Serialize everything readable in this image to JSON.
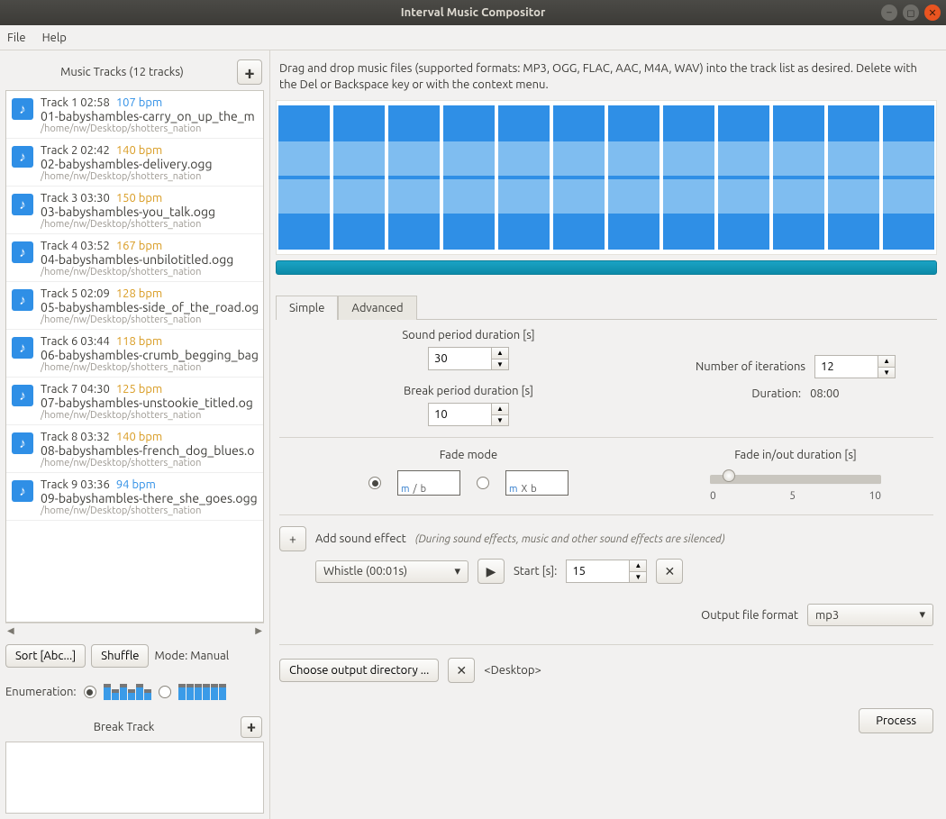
{
  "window": {
    "title": "Interval Music Compositor"
  },
  "menu": {
    "file": "File",
    "help": "Help"
  },
  "sidebar": {
    "tracks_title": "Music Tracks  (12 tracks)",
    "sort_btn": "Sort [Abc...]",
    "shuffle_btn": "Shuffle",
    "mode_label": "Mode:  Manual",
    "enum_label": "Enumeration:",
    "break_title": "Break Track",
    "tracks": [
      {
        "idx": "Track  1",
        "dur": "02:58",
        "bpm": "107 bpm",
        "bpmcolor": "blue",
        "file": "01-babyshambles-carry_on_up_the_m",
        "path": "/home/nw/Desktop/shotters_nation"
      },
      {
        "idx": "Track  2",
        "dur": "02:42",
        "bpm": "140 bpm",
        "bpmcolor": "orange",
        "file": "02-babyshambles-delivery.ogg",
        "path": "/home/nw/Desktop/shotters_nation"
      },
      {
        "idx": "Track  3",
        "dur": "03:30",
        "bpm": "150 bpm",
        "bpmcolor": "orange",
        "file": "03-babyshambles-you_talk.ogg",
        "path": "/home/nw/Desktop/shotters_nation"
      },
      {
        "idx": "Track  4",
        "dur": "03:52",
        "bpm": "167 bpm",
        "bpmcolor": "orange",
        "file": "04-babyshambles-unbilotitled.ogg",
        "path": "/home/nw/Desktop/shotters_nation"
      },
      {
        "idx": "Track  5",
        "dur": "02:09",
        "bpm": "128 bpm",
        "bpmcolor": "orange",
        "file": "05-babyshambles-side_of_the_road.og",
        "path": "/home/nw/Desktop/shotters_nation"
      },
      {
        "idx": "Track  6",
        "dur": "03:44",
        "bpm": "118 bpm",
        "bpmcolor": "orange",
        "file": "06-babyshambles-crumb_begging_bag",
        "path": "/home/nw/Desktop/shotters_nation"
      },
      {
        "idx": "Track  7",
        "dur": "04:30",
        "bpm": "125 bpm",
        "bpmcolor": "orange",
        "file": "07-babyshambles-unstookie_titled.og",
        "path": "/home/nw/Desktop/shotters_nation"
      },
      {
        "idx": "Track  8",
        "dur": "03:32",
        "bpm": "140 bpm",
        "bpmcolor": "orange",
        "file": "08-babyshambles-french_dog_blues.o",
        "path": "/home/nw/Desktop/shotters_nation"
      },
      {
        "idx": "Track  9",
        "dur": "03:36",
        "bpm": "94 bpm",
        "bpmcolor": "blue",
        "file": "09-babyshambles-there_she_goes.ogg",
        "path": "/home/nw/Desktop/shotters_nation"
      }
    ]
  },
  "main": {
    "help": "Drag and drop music files (supported formats: MP3, OGG, FLAC, AAC, M4A, WAV) into the track list as desired. Delete with the Del or Backspace key or with the context menu.",
    "tab_simple": "Simple",
    "tab_advanced": "Advanced",
    "sound_period_label": "Sound period duration [s]",
    "sound_period_value": "30",
    "break_period_label": "Break period duration [s]",
    "break_period_value": "10",
    "iterations_label": "Number of iterations",
    "iterations_value": "12",
    "duration_label": "Duration:",
    "duration_value": "08:00",
    "fade_mode_label": "Fade mode",
    "fade_dur_label": "Fade in/out duration [s]",
    "slider_min": "0",
    "slider_mid": "5",
    "slider_max": "10",
    "sfx_add": "Add sound effect",
    "sfx_note": "(During sound effects, music and other sound effects are silenced)",
    "sfx_combo": "Whistle (00:01s)",
    "sfx_start_label": "Start [s]:",
    "sfx_start_value": "15",
    "out_format_label": "Output file format",
    "out_format_value": "mp3",
    "out_dir_btn": "Choose output directory ...",
    "out_dir_value": "<Desktop>",
    "process_btn": "Process"
  }
}
